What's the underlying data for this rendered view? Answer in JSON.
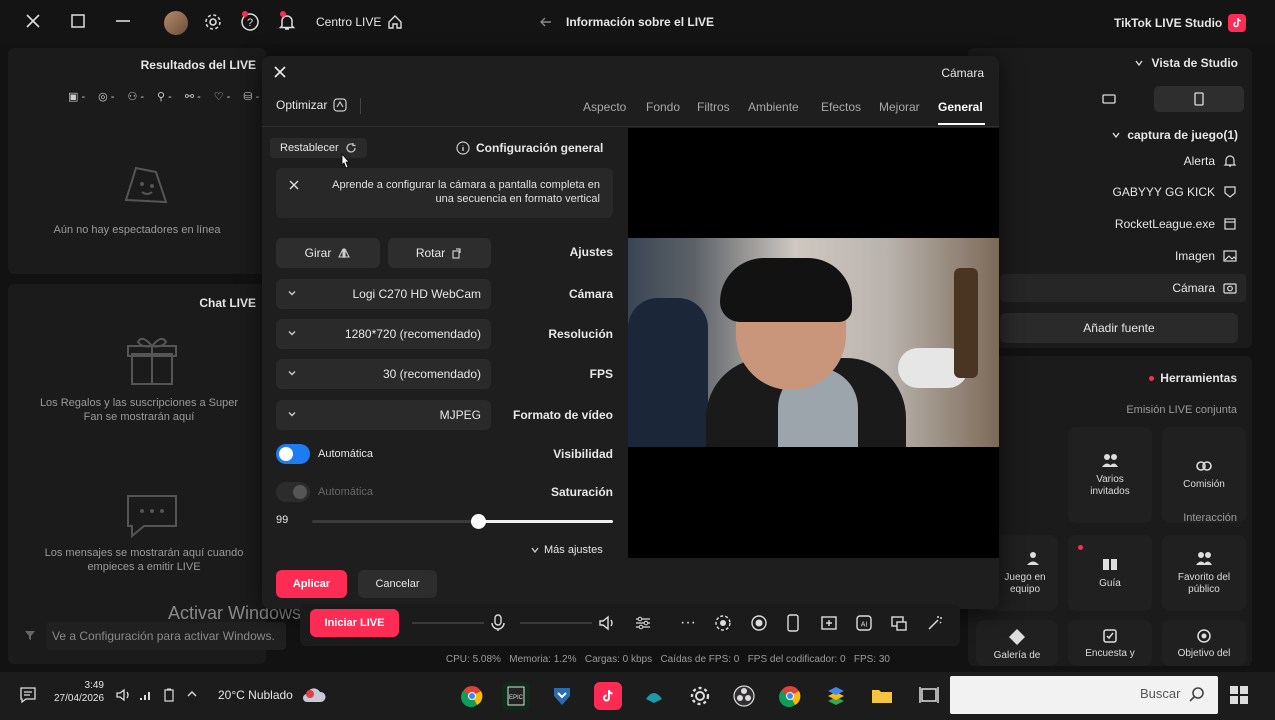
{
  "titlebar": {
    "app_title": "TikTok LIVE Studio",
    "live_info": "Información sobre el LIVE",
    "live_center": "Centro LIVE"
  },
  "left_panel": {
    "results_title": "Resultados del LIVE",
    "no_viewers": "Aún no hay espectadores en línea",
    "gifts_title": "Chat LIVE",
    "gifts_text": "Los Regalos y las suscripciones a Super Fan se mostrarán aquí",
    "messages_text": "Los mensajes se mostrarán aquí cuando empieces a emitir LIVE",
    "activate_title": "Activar Windows",
    "activate_sub": "Ve a Configuración para activar Windows."
  },
  "right_panel": {
    "studio_view": "Vista de Studio",
    "scene": "captura de juego(1)",
    "sources": [
      {
        "label": "Alerta",
        "icon": "bell-icon"
      },
      {
        "label": "GABYYY GG KICK",
        "icon": "shield-icon"
      },
      {
        "label": "RocketLeague.exe",
        "icon": "window-icon"
      },
      {
        "label": "Imagen",
        "icon": "image-icon"
      },
      {
        "label": "Cámara",
        "icon": "camera-icon"
      }
    ],
    "add_source": "Añadir fuente",
    "tools_title": "Herramientas",
    "section_joint": "Emisión LIVE conjunta",
    "section_interaction": "Interacción",
    "tools": {
      "commission": "Comisión",
      "multi_guests": "Varios invitados",
      "public_fav": "Favorito del público",
      "guide": "Guía",
      "team_game": "Juego en equipo",
      "goal": "Objetivo del",
      "survey": "Encuesta y",
      "gallery": "Galería de"
    }
  },
  "modal": {
    "title": "Cámara",
    "tabs": [
      "General",
      "Mejorar",
      "Efectos",
      "Ambiente",
      "Filtros",
      "Fondo",
      "Aspecto"
    ],
    "optimize": "Optimizar",
    "section_title": "Configuración general",
    "reset": "Restablecer",
    "tip": "Aprende a configurar la cámara a pantalla completa en una secuencia en formato vertical",
    "labels": {
      "adjust": "Ajustes",
      "camera": "Cámara",
      "resolution": "Resolución",
      "fps": "FPS",
      "format": "Formato de vídeo",
      "visibility": "Visibilidad",
      "saturation": "Saturación"
    },
    "rotate": "Rotar",
    "flip": "Girar",
    "camera_value": "Logi C270 HD WebCam",
    "resolution_value": "1280*720 (recomendado)",
    "fps_value": "30 (recomendado)",
    "format_value": "MJPEG",
    "auto_label": "Automática",
    "visibility_auto": true,
    "saturation_auto": false,
    "slider_value": "99",
    "slider_level": 0.55,
    "more_settings": "Más ajustes",
    "cancel": "Cancelar",
    "apply": "Aplicar"
  },
  "bottom_bar": {
    "start_live": "Iniciar LIVE",
    "stats": "CPU: 5.08%   Memoria: 1.2%   Cargas: 0 kbps   Caídas de FPS: 0   FPS del codificador: 0   FPS: 30"
  },
  "taskbar": {
    "search_placeholder": "Buscar",
    "weather": "20°C Nublado",
    "time": "3:49",
    "date": "27/04/2026"
  },
  "colors": {
    "accent_pink": "#fe2c55",
    "toggle_blue": "#1e7cf2"
  }
}
